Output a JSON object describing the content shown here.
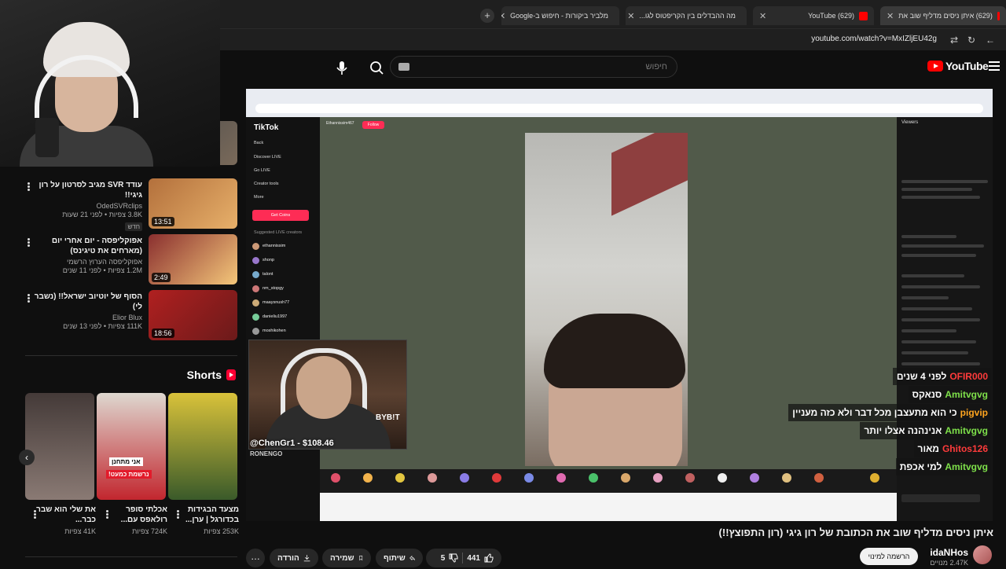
{
  "browser": {
    "tabs": [
      {
        "label": "(629) איתן ניסים מדליף שוב את",
        "active": true,
        "favicon_color": "#ff0000"
      },
      {
        "label": "(629) YouTube",
        "active": false,
        "favicon_color": "#ff0000"
      },
      {
        "label": "מה ההבדלים בין הקריפטוס לגו...",
        "active": false,
        "favicon_color": "#999999"
      },
      {
        "label": "מלביר ביקורות - חיפוש ב-Google",
        "active": false,
        "favicon_color": "#999999"
      }
    ],
    "new_tab": "+",
    "url": "youtube.com/watch?v=MxIZljEU42g"
  },
  "youtube": {
    "logo_text": "YouTube",
    "search_placeholder": "חיפוש"
  },
  "sidebar": {
    "recommendations": [
      {
        "title": "עודד SVR מגיב לסרטון על רון גיגי!!",
        "channel": "OdedSVRclips",
        "stats": "3.8K צפיות • לפני 21 שעות",
        "badge": "חדש",
        "duration": "13:51",
        "thumb_colors": [
          "#b3703c",
          "#e7b06a"
        ]
      },
      {
        "title": "אפוקליפסה - יום אחרי יום (מארחים את טיגינס)",
        "channel": "אפוקליפסה הערוץ הרשמי",
        "stats": "1.2M צפיות • לפני 11 שנים",
        "badge": "",
        "duration": "2:49",
        "thumb_colors": [
          "#8a2f2f",
          "#f4c77a"
        ]
      },
      {
        "title": "הסוף של יוטיוב ישראל!! (נשבר לי)",
        "channel": "Elior Blux",
        "stats": "111K צפיות • לפני 13 שנים",
        "badge": "",
        "duration": "18:56",
        "thumb_colors": [
          "#b02020",
          "#6b1a1a"
        ]
      }
    ],
    "shorts_label": "Shorts",
    "shorts": [
      {
        "title": "מצעד הבגידות בכדורגל | ערן...",
        "views": "253K צפיות",
        "colors": [
          "#d9c23a",
          "#3a5a2a"
        ]
      },
      {
        "title": "אכלתי סופר רולאפס עם...",
        "views": "724K צפיות",
        "colors": [
          "#ded8d0",
          "#c2262e"
        ],
        "overlay": "אני מתחנן",
        "overlay2": "נרשמת כמעט!"
      },
      {
        "title": "את שלי הוא שבר כבר...",
        "views": "41K צפיות",
        "colors": [
          "#443a38",
          "#8a7a74"
        ]
      }
    ]
  },
  "player": {
    "tiktok": {
      "logo": "TikTok",
      "menu": [
        "Back",
        "Discover LIVE",
        "Go LIVE",
        "Creator tools",
        "More"
      ],
      "get_coins": "Get Coins",
      "suggested": "Suggested LIVE creators",
      "users": [
        "ethannissim",
        "shonp",
        "talont",
        "nm_stopgy",
        "maaysnush77",
        "danieliu1997",
        "moshikohen"
      ],
      "follow": "Follow",
      "stream_user": "Ethannissim467",
      "viewers_head": "Viewers"
    },
    "streamer": {
      "donation": "@ChenGr1 - $108.46",
      "sponsor": "BYB!T",
      "brand": "RONENGO"
    },
    "chat": [
      {
        "name": "OFIR000",
        "text": "לפני 4 שנים",
        "color": "#ff3b3b"
      },
      {
        "name": "Amitvgvg",
        "text": "סנאקס",
        "color": "#7ee04a"
      },
      {
        "name": "pigvip",
        "text": "כי הוא מתעצבן מכל דבר ולא כזה מעניין",
        "color": "#ffa51f"
      },
      {
        "name": "Amitvgvg",
        "text": "אנינהנה אצלו יותר",
        "color": "#7ee04a"
      },
      {
        "name": "Ghitos126",
        "text": "מאור",
        "color": "#ff3b3b"
      },
      {
        "name": "Amitvgvg",
        "text": "למי אכפת",
        "color": "#7ee04a"
      }
    ]
  },
  "video": {
    "title": "איתן ניסים מדליף שוב את הכתובת של רון גיגי (רון התפוצץ!!)",
    "channel": "idaNHos",
    "subscribers": "2.47K מנויים",
    "subscribe": "הרשמה למינוי",
    "likes": "441",
    "dislikes": "5",
    "share": "שיתוף",
    "save": "שמירה",
    "download": "הורדה",
    "more": "…"
  }
}
